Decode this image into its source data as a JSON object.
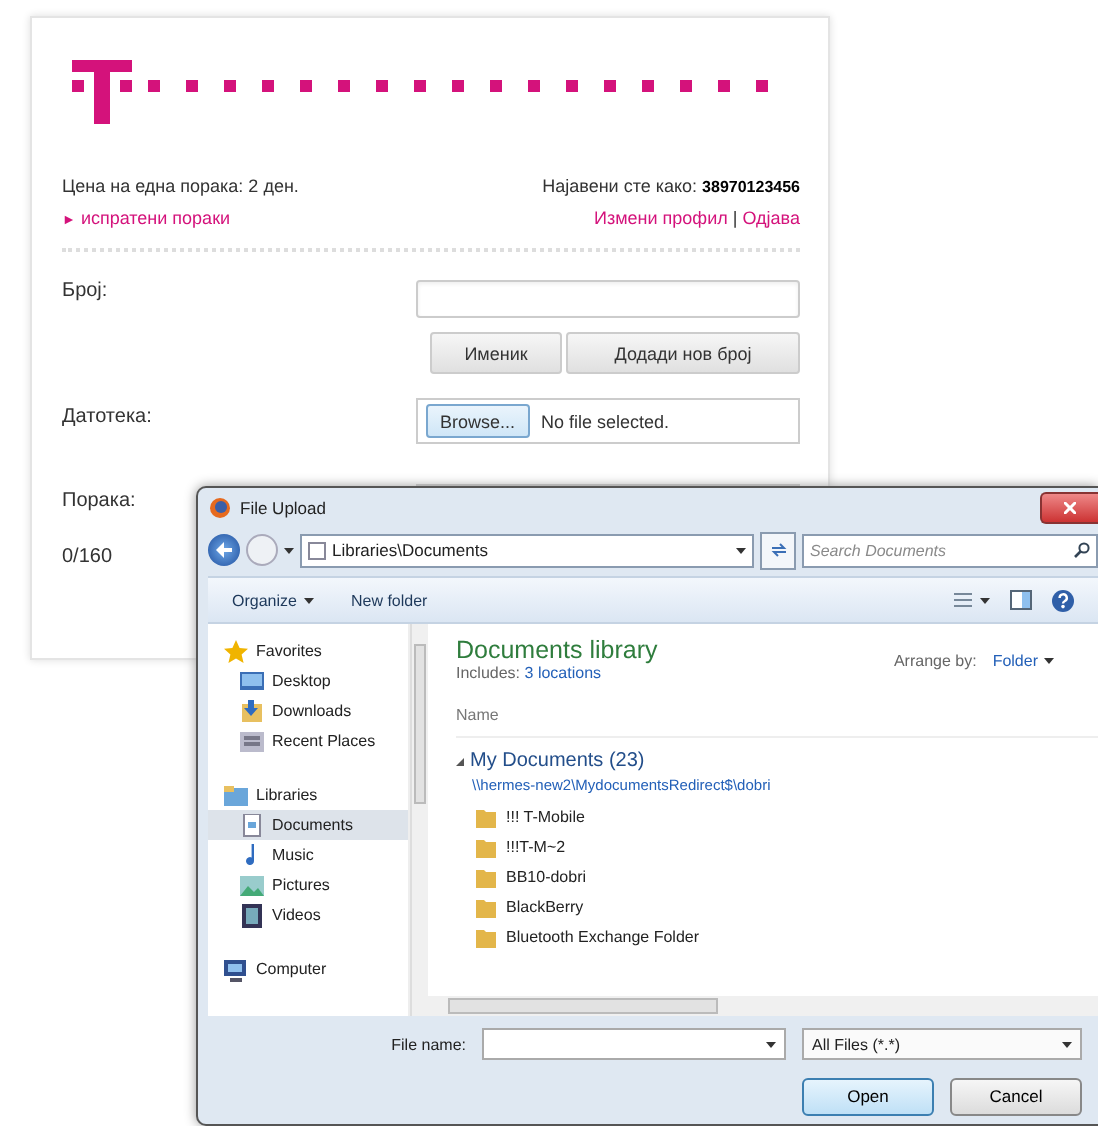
{
  "page": {
    "price": "Цена на една порака: 2 ден.",
    "logged_in_label": "Најавени сте како:",
    "phone": "38970123456",
    "sent_link_marker": "►",
    "sent_link": "испратени пораки",
    "profile_link": "Измени профил",
    "link_separator": "|",
    "logout_link": "Одјава",
    "number_label": "Број:",
    "phonebook_button": "Именик",
    "add_number_button": "Додади нов број",
    "file_label": "Датотека:",
    "browse_button": "Browse...",
    "file_status": "No file selected.",
    "message_label": "Порака:",
    "counter": "0/160"
  },
  "dialog": {
    "title": "File Upload",
    "address": "Libraries\\Documents",
    "search_placeholder": "Search Documents",
    "toolbar": [
      "Organize",
      "New folder"
    ],
    "nav": [
      {
        "label": "Favorites",
        "selected": false,
        "children": [
          {
            "label": "Desktop",
            "selected": false
          },
          {
            "label": "Downloads",
            "selected": false
          },
          {
            "label": "Recent Places",
            "selected": false
          }
        ]
      },
      {
        "label": "Libraries",
        "selected": false,
        "children": [
          {
            "label": "Documents",
            "selected": true
          },
          {
            "label": "Music",
            "selected": false
          },
          {
            "label": "Pictures",
            "selected": false
          },
          {
            "label": "Videos",
            "selected": false
          }
        ]
      },
      {
        "label": "Computer",
        "selected": false
      }
    ],
    "library_title": "Documents library",
    "includes_label": "Includes:",
    "includes_link": "3 locations",
    "arrange_label": "Arrange by:",
    "arrange_value": "Folder",
    "column": "Name",
    "group": "My Documents (23)",
    "group_path": "\\\\hermes-new2\\MydocumentsRedirect$\\dobri",
    "files": [
      "!!! T-Mobile",
      "!!!T-M~2",
      "BB10-dobri",
      "BlackBerry",
      "Bluetooth Exchange Folder"
    ],
    "file_name_label": "File name:",
    "filter": "All Files (*.*)",
    "open_button": "Open",
    "cancel_button": "Cancel"
  }
}
